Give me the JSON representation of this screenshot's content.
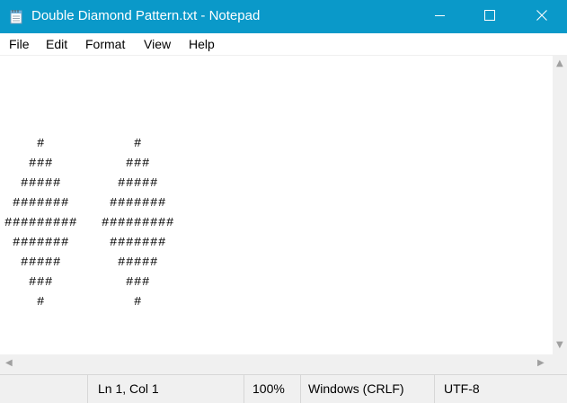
{
  "window": {
    "title": "Double Diamond Pattern.txt - Notepad",
    "icons": {
      "app": "notepad-icon",
      "minimize": "minimize-icon",
      "maximize": "maximize-icon",
      "close": "close-icon"
    },
    "accent_color": "#0a99c9"
  },
  "menu": {
    "file": "File",
    "edit": "Edit",
    "format": "Format",
    "view": "View",
    "help": "Help"
  },
  "document": {
    "content": "\n\n    #           #\n   ###         ###\n  #####       #####\n #######     #######\n#########   #########\n #######     #######\n  #####       #####\n   ###         ###\n    #           #"
  },
  "status": {
    "position": "Ln 1, Col 1",
    "zoom": "100%",
    "line_ending": "Windows (CRLF)",
    "encoding": "UTF-8"
  }
}
